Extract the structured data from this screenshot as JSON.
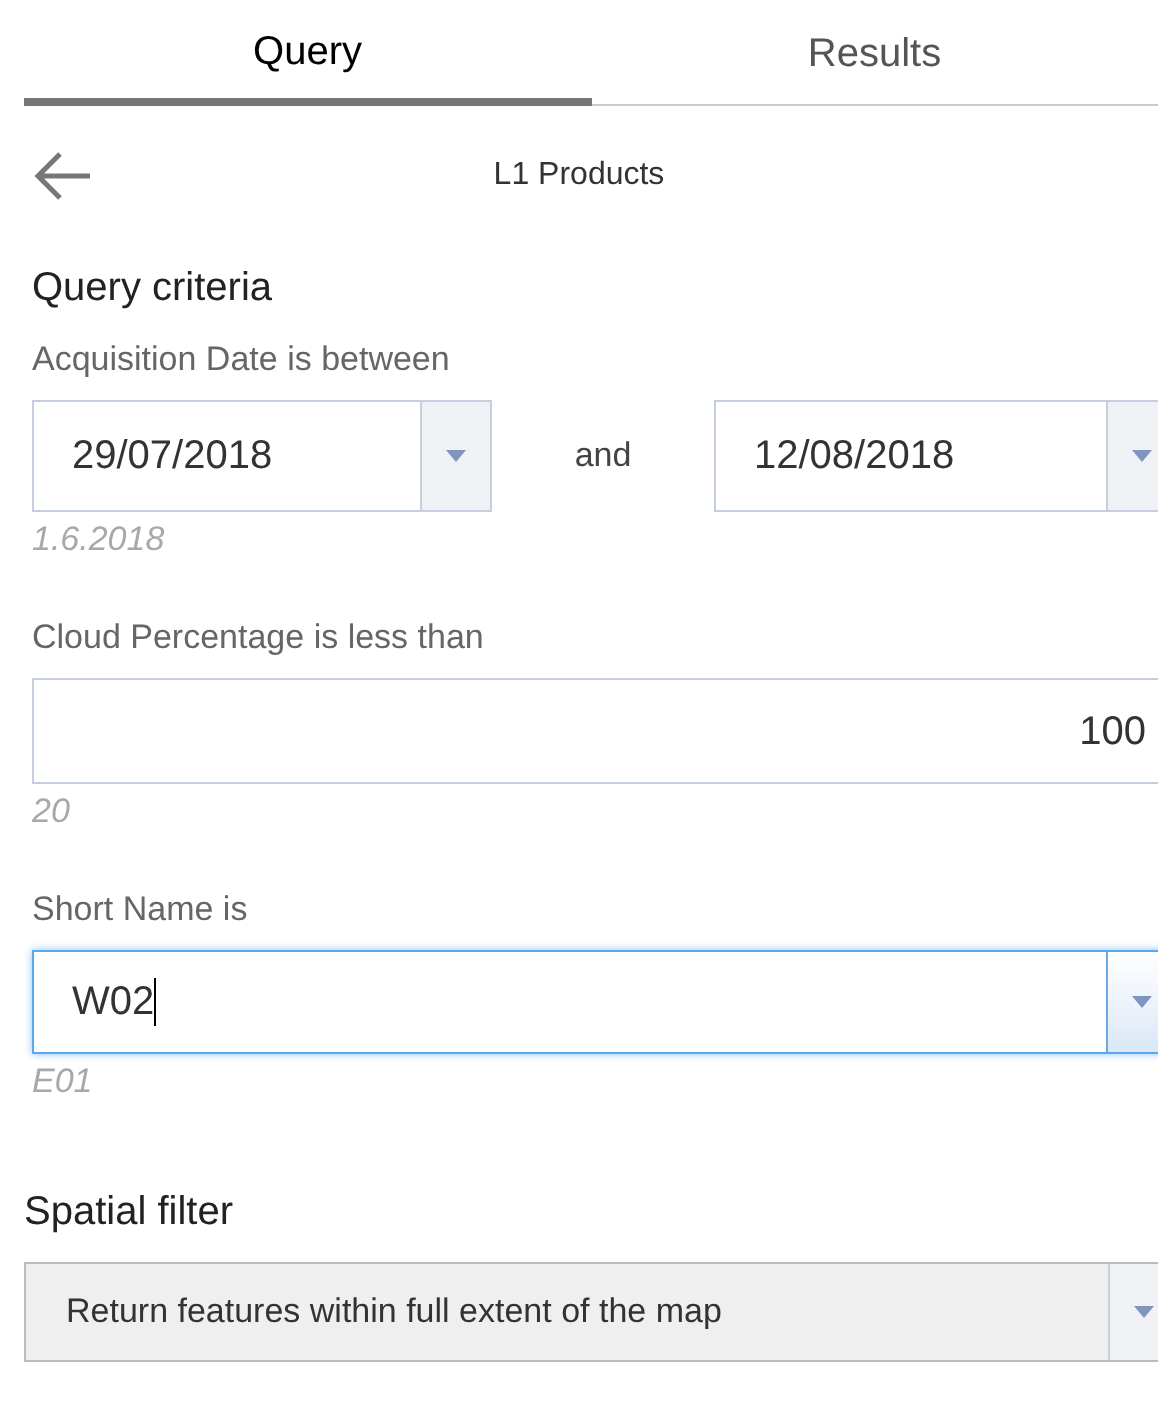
{
  "tabs": [
    {
      "label": "Query",
      "selected": true
    },
    {
      "label": "Results",
      "selected": false
    }
  ],
  "header": {
    "title": "L1 Products"
  },
  "query_criteria": {
    "title": "Query criteria",
    "fields": [
      {
        "kind": "date_range",
        "label": "Acquisition Date is between",
        "from": "29/07/2018",
        "joiner": "and",
        "to": "12/08/2018",
        "hint": "1.6.2018"
      },
      {
        "kind": "number",
        "label": "Cloud Percentage is less than",
        "value": "100",
        "hint": "20"
      },
      {
        "kind": "combo",
        "label": "Short Name is",
        "value": "W02",
        "hint": "E01",
        "focused": true
      }
    ]
  },
  "spatial_filter": {
    "title": "Spatial filter",
    "value": "Return features within full extent of the map"
  }
}
